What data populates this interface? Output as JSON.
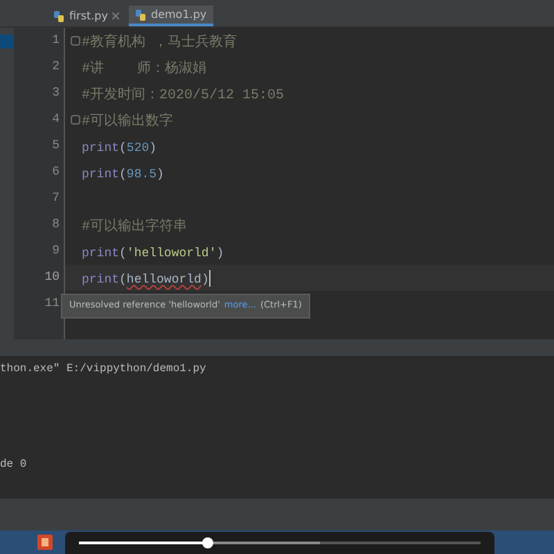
{
  "tabs": [
    {
      "label": "first.py",
      "selected": false,
      "closable": true
    },
    {
      "label": "demo1.py",
      "selected": true,
      "closable": false
    }
  ],
  "lines": [
    {
      "number": "1",
      "fold": true,
      "current": false,
      "parts": [
        {
          "text": "#教育机构 ，马士兵教育",
          "kind": "comment"
        }
      ]
    },
    {
      "number": "2",
      "fold": false,
      "current": false,
      "parts": [
        {
          "text": "#讲    师：杨淑娟",
          "kind": "comment"
        }
      ]
    },
    {
      "number": "3",
      "fold": false,
      "current": false,
      "parts": [
        {
          "text": "#开发时间：2020/5/12 15:05",
          "kind": "comment"
        }
      ]
    },
    {
      "number": "4",
      "fold": true,
      "current": false,
      "parts": [
        {
          "text": "#可以输出数字",
          "kind": "comment"
        }
      ]
    },
    {
      "number": "5",
      "fold": false,
      "current": false,
      "parts": [
        {
          "text": "print",
          "kind": "builtin"
        },
        {
          "text": "(",
          "kind": "plain"
        },
        {
          "text": "520",
          "kind": "number"
        },
        {
          "text": ")",
          "kind": "plain"
        }
      ]
    },
    {
      "number": "6",
      "fold": false,
      "current": false,
      "parts": [
        {
          "text": "print",
          "kind": "builtin"
        },
        {
          "text": "(",
          "kind": "plain"
        },
        {
          "text": "98.5",
          "kind": "number"
        },
        {
          "text": ")",
          "kind": "plain"
        }
      ]
    },
    {
      "number": "7",
      "fold": false,
      "current": false
    },
    {
      "number": "8",
      "fold": false,
      "current": false,
      "parts": [
        {
          "text": "#可以输出字符串",
          "kind": "comment"
        }
      ]
    },
    {
      "number": "9",
      "fold": false,
      "current": false,
      "parts": [
        {
          "text": "print",
          "kind": "builtin"
        },
        {
          "text": "(",
          "kind": "plain"
        },
        {
          "text": "'helloworld'",
          "kind": "string"
        },
        {
          "text": ")",
          "kind": "plain"
        }
      ]
    },
    {
      "number": "10",
      "fold": false,
      "current": true,
      "parts": [
        {
          "text": "print",
          "kind": "builtin"
        },
        {
          "text": "(",
          "kind": "plain"
        },
        {
          "text": "helloworld",
          "kind": "error"
        },
        {
          "text": ")",
          "kind": "plain"
        }
      ]
    },
    {
      "number": "11",
      "current": false
    }
  ],
  "tooltip": {
    "text": "Unresolved reference 'helloworld'",
    "link": "more...",
    "shortcut": "(Ctrl+F1)"
  },
  "console": {
    "lines": [
      "thon.exe\" E:/vippython/demo1.py",
      "de 0"
    ]
  },
  "player": {
    "progress": {
      "level": 0.32
    },
    "buffer": {
      "level": 0.6
    }
  }
}
